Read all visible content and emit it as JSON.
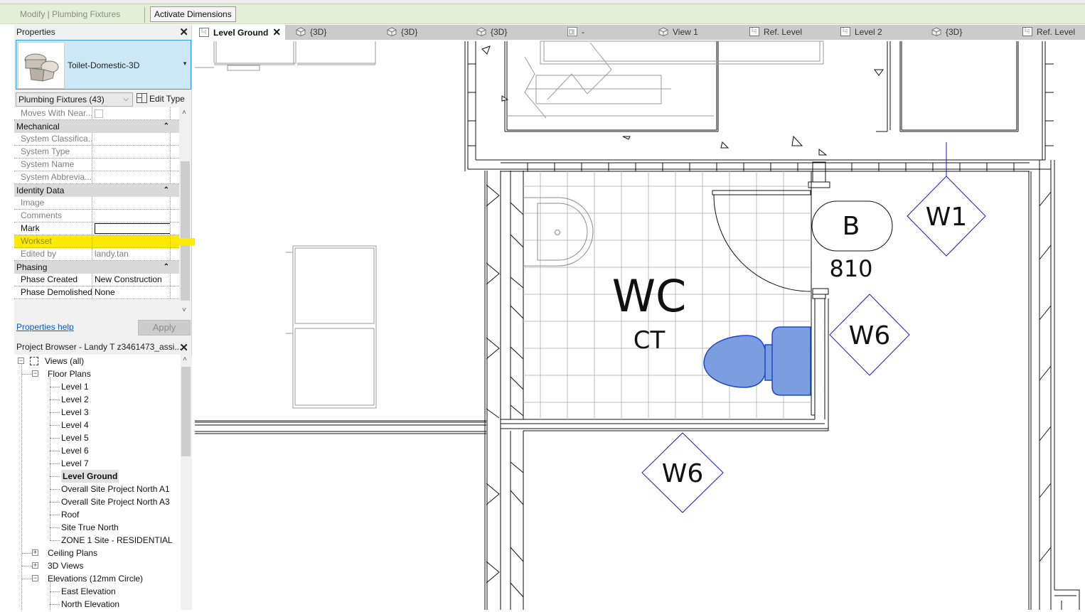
{
  "ribbon": {
    "context_label": "Modify | Plumbing Fixtures",
    "activate_dimensions": "Activate Dimensions"
  },
  "properties": {
    "title": "Properties",
    "close_glyph": "✕",
    "type_name": "Toilet-Domestic-3D",
    "category_filter": "Plumbing Fixtures (43)",
    "edit_type_label": "Edit Type",
    "rows": {
      "moves_with_nearby": "Moves With Near...",
      "group_mechanical": "Mechanical",
      "system_classification": "System Classifica...",
      "system_type": "System Type",
      "system_name": "System Name",
      "system_abbreviation": "System Abbrevia...",
      "group_identity": "Identity Data",
      "image": "Image",
      "comments": "Comments",
      "mark": "Mark",
      "mark_value": "",
      "workset": "Workset",
      "edited_by": "Edited by",
      "edited_by_value": "landy.tan",
      "group_phasing": "Phasing",
      "phase_created": "Phase Created",
      "phase_created_value": "New Construction",
      "phase_demolished": "Phase Demolished",
      "phase_demolished_value": "None"
    },
    "help_link": "Properties help",
    "apply_label": "Apply",
    "highlight_color": "#ffe900"
  },
  "browser": {
    "title": "Project Browser - Landy T z3461473_assi...",
    "close_glyph": "✕",
    "root": "Views (all)",
    "floor_plans": "Floor Plans",
    "floor_plan_items": [
      "Level 1",
      "Level 2",
      "Level 3",
      "Level 4",
      "Level 5",
      "Level 6",
      "Level 7",
      "Level Ground",
      "Overall Site Project North A1",
      "Overall Site Project North A3",
      "Roof",
      "Site True North",
      "ZONE 1 Site - RESIDENTIAL"
    ],
    "selected_item": "Level Ground",
    "ceiling_plans": "Ceiling Plans",
    "views_3d": "3D Views",
    "elevations": "Elevations (12mm Circle)",
    "elevation_items": [
      "East Elevation",
      "North Elevation"
    ]
  },
  "tabs": [
    {
      "label": "Level Ground",
      "icon": "floor-plan-icon",
      "active": true
    },
    {
      "label": "{3D}",
      "icon": "3d-view-icon"
    },
    {
      "label": "{3D}",
      "icon": "3d-view-icon"
    },
    {
      "label": "{3D}",
      "icon": "3d-view-icon"
    },
    {
      "label": "-",
      "icon": "sheet-icon"
    },
    {
      "label": "View 1",
      "icon": "3d-view-icon"
    },
    {
      "label": "Ref. Level",
      "icon": "floor-plan-icon"
    },
    {
      "label": "Level 2",
      "icon": "floor-plan-icon"
    },
    {
      "label": "{3D}",
      "icon": "3d-view-icon"
    },
    {
      "label": "Ref. Level",
      "icon": "floor-plan-icon"
    }
  ],
  "tab_close_glyph": "✕",
  "drawing": {
    "room_name": "WC",
    "room_number": "CT",
    "door_tag": "B",
    "door_width": "810",
    "window_tags": [
      "W1",
      "W6",
      "W6"
    ],
    "selection_color": "#7b9ee0",
    "selection_stroke": "#1e45c8",
    "tag_stroke": "#1a1ad0"
  }
}
